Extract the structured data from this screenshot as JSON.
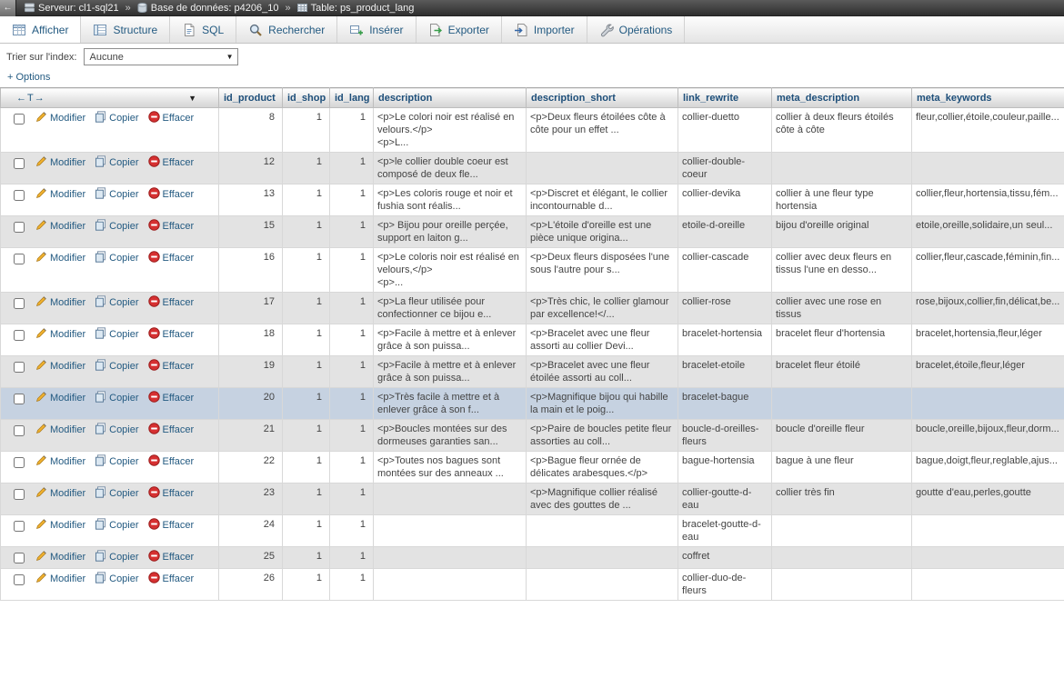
{
  "topbar": {
    "back_arrow": "←",
    "separator": "»",
    "server": "Serveur: cl1-sql21",
    "database": "Base de données: p4206_10",
    "table": "Table: ps_product_lang"
  },
  "tabs": [
    {
      "label": "Afficher"
    },
    {
      "label": "Structure"
    },
    {
      "label": "SQL"
    },
    {
      "label": "Rechercher"
    },
    {
      "label": "Insérer"
    },
    {
      "label": "Exporter"
    },
    {
      "label": "Importer"
    },
    {
      "label": "Opérations"
    }
  ],
  "sort_bar": {
    "label": "Trier sur l'index:",
    "selected": "Aucune"
  },
  "options_toggle": "+ Options",
  "grid": {
    "corner_label": "←T→",
    "sort_arrow": "▼",
    "actions": {
      "edit": "Modifier",
      "copy": "Copier",
      "delete": "Effacer"
    },
    "columns": [
      "id_product",
      "id_shop",
      "id_lang",
      "description",
      "description_short",
      "link_rewrite",
      "meta_description",
      "meta_keywords"
    ],
    "colors": {
      "link": "#235a81",
      "header_text": "#1d4e79",
      "row_alt": "#e3e3e3",
      "row_marked": "#c6d2e1",
      "delete_icon": "#d63031",
      "pencil_icon": "#efb02e"
    },
    "rows": [
      {
        "id_product": 8,
        "id_shop": 1,
        "id_lang": 1,
        "description": "<p>Le colori noir est réalisé en velours.</p>\n<p>L...",
        "description_short": "<p>Deux fleurs étoilées côte à côte pour un effet ...",
        "link_rewrite": "collier-duetto",
        "meta_description": "collier à deux fleurs étoilés côte à côte",
        "meta_keywords": "fleur,collier,étoile,couleur,paille...",
        "highlighted": false
      },
      {
        "id_product": 12,
        "id_shop": 1,
        "id_lang": 1,
        "description": "<p>le collier double coeur est composé de deux fle...",
        "description_short": "",
        "link_rewrite": "collier-double-coeur",
        "meta_description": "",
        "meta_keywords": "",
        "highlighted": false
      },
      {
        "id_product": 13,
        "id_shop": 1,
        "id_lang": 1,
        "description": "<p>Les coloris rouge et noir et fushia sont réalis...",
        "description_short": "<p>Discret et élégant, le collier incontournable d...",
        "link_rewrite": "collier-devika",
        "meta_description": "collier à une fleur type hortensia",
        "meta_keywords": "collier,fleur,hortensia,tissu,fém...",
        "highlighted": false
      },
      {
        "id_product": 15,
        "id_shop": 1,
        "id_lang": 1,
        "description": "<p> Bijou pour oreille perçée, support en laiton g...",
        "description_short": "<p>L'étoile d'oreille est une pièce unique origina...",
        "link_rewrite": "etoile-d-oreille",
        "meta_description": "bijou d'oreille original",
        "meta_keywords": "etoile,oreille,solidaire,un seul...",
        "highlighted": false
      },
      {
        "id_product": 16,
        "id_shop": 1,
        "id_lang": 1,
        "description": "<p>Le coloris noir est réalisé en velours,</p>\n<p>...",
        "description_short": "<p>Deux fleurs disposées l'une sous l'autre pour s...",
        "link_rewrite": "collier-cascade",
        "meta_description": "collier avec deux fleurs en tissus  l'une en desso...",
        "meta_keywords": "collier,fleur,cascade,féminin,fin...",
        "highlighted": false
      },
      {
        "id_product": 17,
        "id_shop": 1,
        "id_lang": 1,
        "description": "<p>La fleur utilisée pour confectionner ce bijou e...",
        "description_short": "<p>Très chic, le collier glamour par excellence!</...",
        "link_rewrite": "collier-rose",
        "meta_description": "collier avec une rose en tissus",
        "meta_keywords": "rose,bijoux,collier,fin,délicat,be...",
        "highlighted": false
      },
      {
        "id_product": 18,
        "id_shop": 1,
        "id_lang": 1,
        "description": "<p>Facile à mettre et à enlever grâce à son puissa...",
        "description_short": "<p>Bracelet avec une fleur assorti au collier Devi...",
        "link_rewrite": "bracelet-hortensia",
        "meta_description": "bracelet fleur d'hortensia",
        "meta_keywords": "bracelet,hortensia,fleur,léger",
        "highlighted": false
      },
      {
        "id_product": 19,
        "id_shop": 1,
        "id_lang": 1,
        "description": "<p>Facile à mettre et à enlever grâce à son puissa...",
        "description_short": "<p>Bracelet avec une fleur étoilée assorti au coll...",
        "link_rewrite": "bracelet-etoile",
        "meta_description": "bracelet fleur étoilé",
        "meta_keywords": "bracelet,étoile,fleur,léger",
        "highlighted": false
      },
      {
        "id_product": 20,
        "id_shop": 1,
        "id_lang": 1,
        "description": "<p>Très facile à mettre et à enlever grâce à son f...",
        "description_short": "<p>Magnifique bijou qui habille la main et le poig...",
        "link_rewrite": "bracelet-bague",
        "meta_description": "",
        "meta_keywords": "",
        "highlighted": true
      },
      {
        "id_product": 21,
        "id_shop": 1,
        "id_lang": 1,
        "description": "<p>Boucles montées sur des dormeuses garanties san...",
        "description_short": "<p>Paire de boucles petite fleur assorties au coll...",
        "link_rewrite": "boucle-d-oreilles-fleurs",
        "meta_description": "boucle d'oreille fleur",
        "meta_keywords": "boucle,oreille,bijoux,fleur,dorm...",
        "highlighted": false
      },
      {
        "id_product": 22,
        "id_shop": 1,
        "id_lang": 1,
        "description": "<p>Toutes nos bagues sont montées sur des anneaux ...",
        "description_short": "<p>Bague fleur ornée de délicates arabesques.</p>",
        "link_rewrite": "bague-hortensia",
        "meta_description": "bague à une fleur",
        "meta_keywords": "bague,doigt,fleur,reglable,ajus...",
        "highlighted": false
      },
      {
        "id_product": 23,
        "id_shop": 1,
        "id_lang": 1,
        "description": "",
        "description_short": "<p>Magnifique collier réalisé avec des gouttes de ...",
        "link_rewrite": "collier-goutte-d-eau",
        "meta_description": "collier très fin",
        "meta_keywords": "goutte d'eau,perles,goutte",
        "highlighted": false
      },
      {
        "id_product": 24,
        "id_shop": 1,
        "id_lang": 1,
        "description": "",
        "description_short": "",
        "link_rewrite": "bracelet-goutte-d-eau",
        "meta_description": "",
        "meta_keywords": "",
        "highlighted": false
      },
      {
        "id_product": 25,
        "id_shop": 1,
        "id_lang": 1,
        "description": "",
        "description_short": "",
        "link_rewrite": "coffret",
        "meta_description": "",
        "meta_keywords": "",
        "highlighted": false
      },
      {
        "id_product": 26,
        "id_shop": 1,
        "id_lang": 1,
        "description": "",
        "description_short": "",
        "link_rewrite": "collier-duo-de-fleurs",
        "meta_description": "",
        "meta_keywords": "",
        "highlighted": false
      }
    ]
  }
}
